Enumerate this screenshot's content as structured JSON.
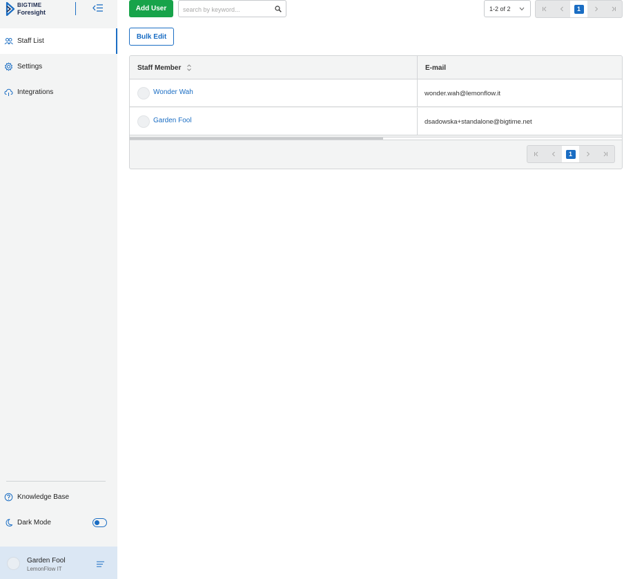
{
  "brand": {
    "line1": "BIGTIME",
    "line2": "Foresight",
    "color": "#1a6dc3"
  },
  "sidebar": {
    "items": [
      {
        "label": "Staff List",
        "icon": "users-icon",
        "active": true
      },
      {
        "label": "Settings",
        "icon": "gear-icon",
        "active": false
      },
      {
        "label": "Integrations",
        "icon": "cloud-icon",
        "active": false
      }
    ],
    "knowledge_base": "Knowledge Base",
    "dark_mode": "Dark Mode",
    "dark_mode_enabled": true,
    "user": {
      "name": "Garden Fool",
      "org": "LemonFlow IT"
    }
  },
  "toolbar": {
    "add_user_label": "Add User",
    "search_placeholder": "search by keyword...",
    "page_range": "1-2 of 2",
    "current_page": "1",
    "bulk_edit_label": "Bulk Edit"
  },
  "table": {
    "columns": [
      "Staff Member",
      "E-mail"
    ],
    "rows": [
      {
        "name": "Wonder Wah",
        "email": "wonder.wah@lemonflow.it"
      },
      {
        "name": "Garden Fool",
        "email": "dsadowska+standalone@bigtime.net"
      }
    ],
    "footer_page": "1"
  },
  "colors": {
    "accent": "#1a6dc3",
    "add_button": "#17a34a",
    "sidebar_bg": "#f3f4f4",
    "user_box_bg": "#dbe7f4"
  }
}
